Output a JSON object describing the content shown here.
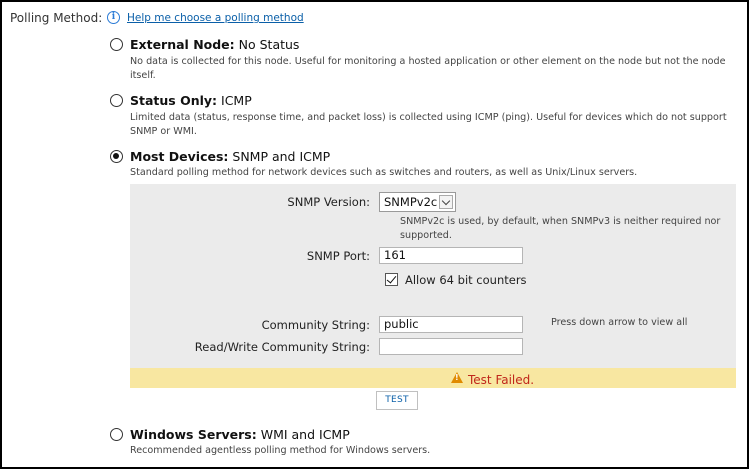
{
  "polling": {
    "label": "Polling Method:",
    "help_link": "Help me choose a polling method"
  },
  "options": [
    {
      "title_bold": "External Node:",
      "title_rest": " No Status",
      "description": "No data is collected for this node. Useful for monitoring a hosted application or other element on the node but not the node itself.",
      "selected": false
    },
    {
      "title_bold": "Status Only:",
      "title_rest": " ICMP",
      "description": "Limited data (status, response time, and packet loss) is collected using ICMP (ping). Useful for devices which do not support SNMP or WMI.",
      "selected": false
    },
    {
      "title_bold": "Most Devices:",
      "title_rest": " SNMP and ICMP",
      "description": "Standard polling method for network devices such as switches and routers, as well as Unix/Linux servers.",
      "selected": true
    },
    {
      "title_bold": "Windows Servers:",
      "title_rest": " WMI and ICMP",
      "description": "Recommended agentless polling method for Windows servers.",
      "selected": false
    }
  ],
  "snmp": {
    "version_label": "SNMP Version:",
    "version_value": "SNMPv2c",
    "version_note": "SNMPv2c is used, by default, when SNMPv3 is neither required nor supported.",
    "port_label": "SNMP Port:",
    "port_value": "161",
    "allow64_label": "Allow 64 bit counters",
    "allow64_checked": true,
    "community_label": "Community String:",
    "community_value": "public",
    "community_hint": "Press down arrow to view all",
    "rw_community_label": "Read/Write Community String:",
    "rw_community_value": ""
  },
  "status": {
    "message": "Test Failed.",
    "color": "#c0271b"
  },
  "test_button": "TEST"
}
